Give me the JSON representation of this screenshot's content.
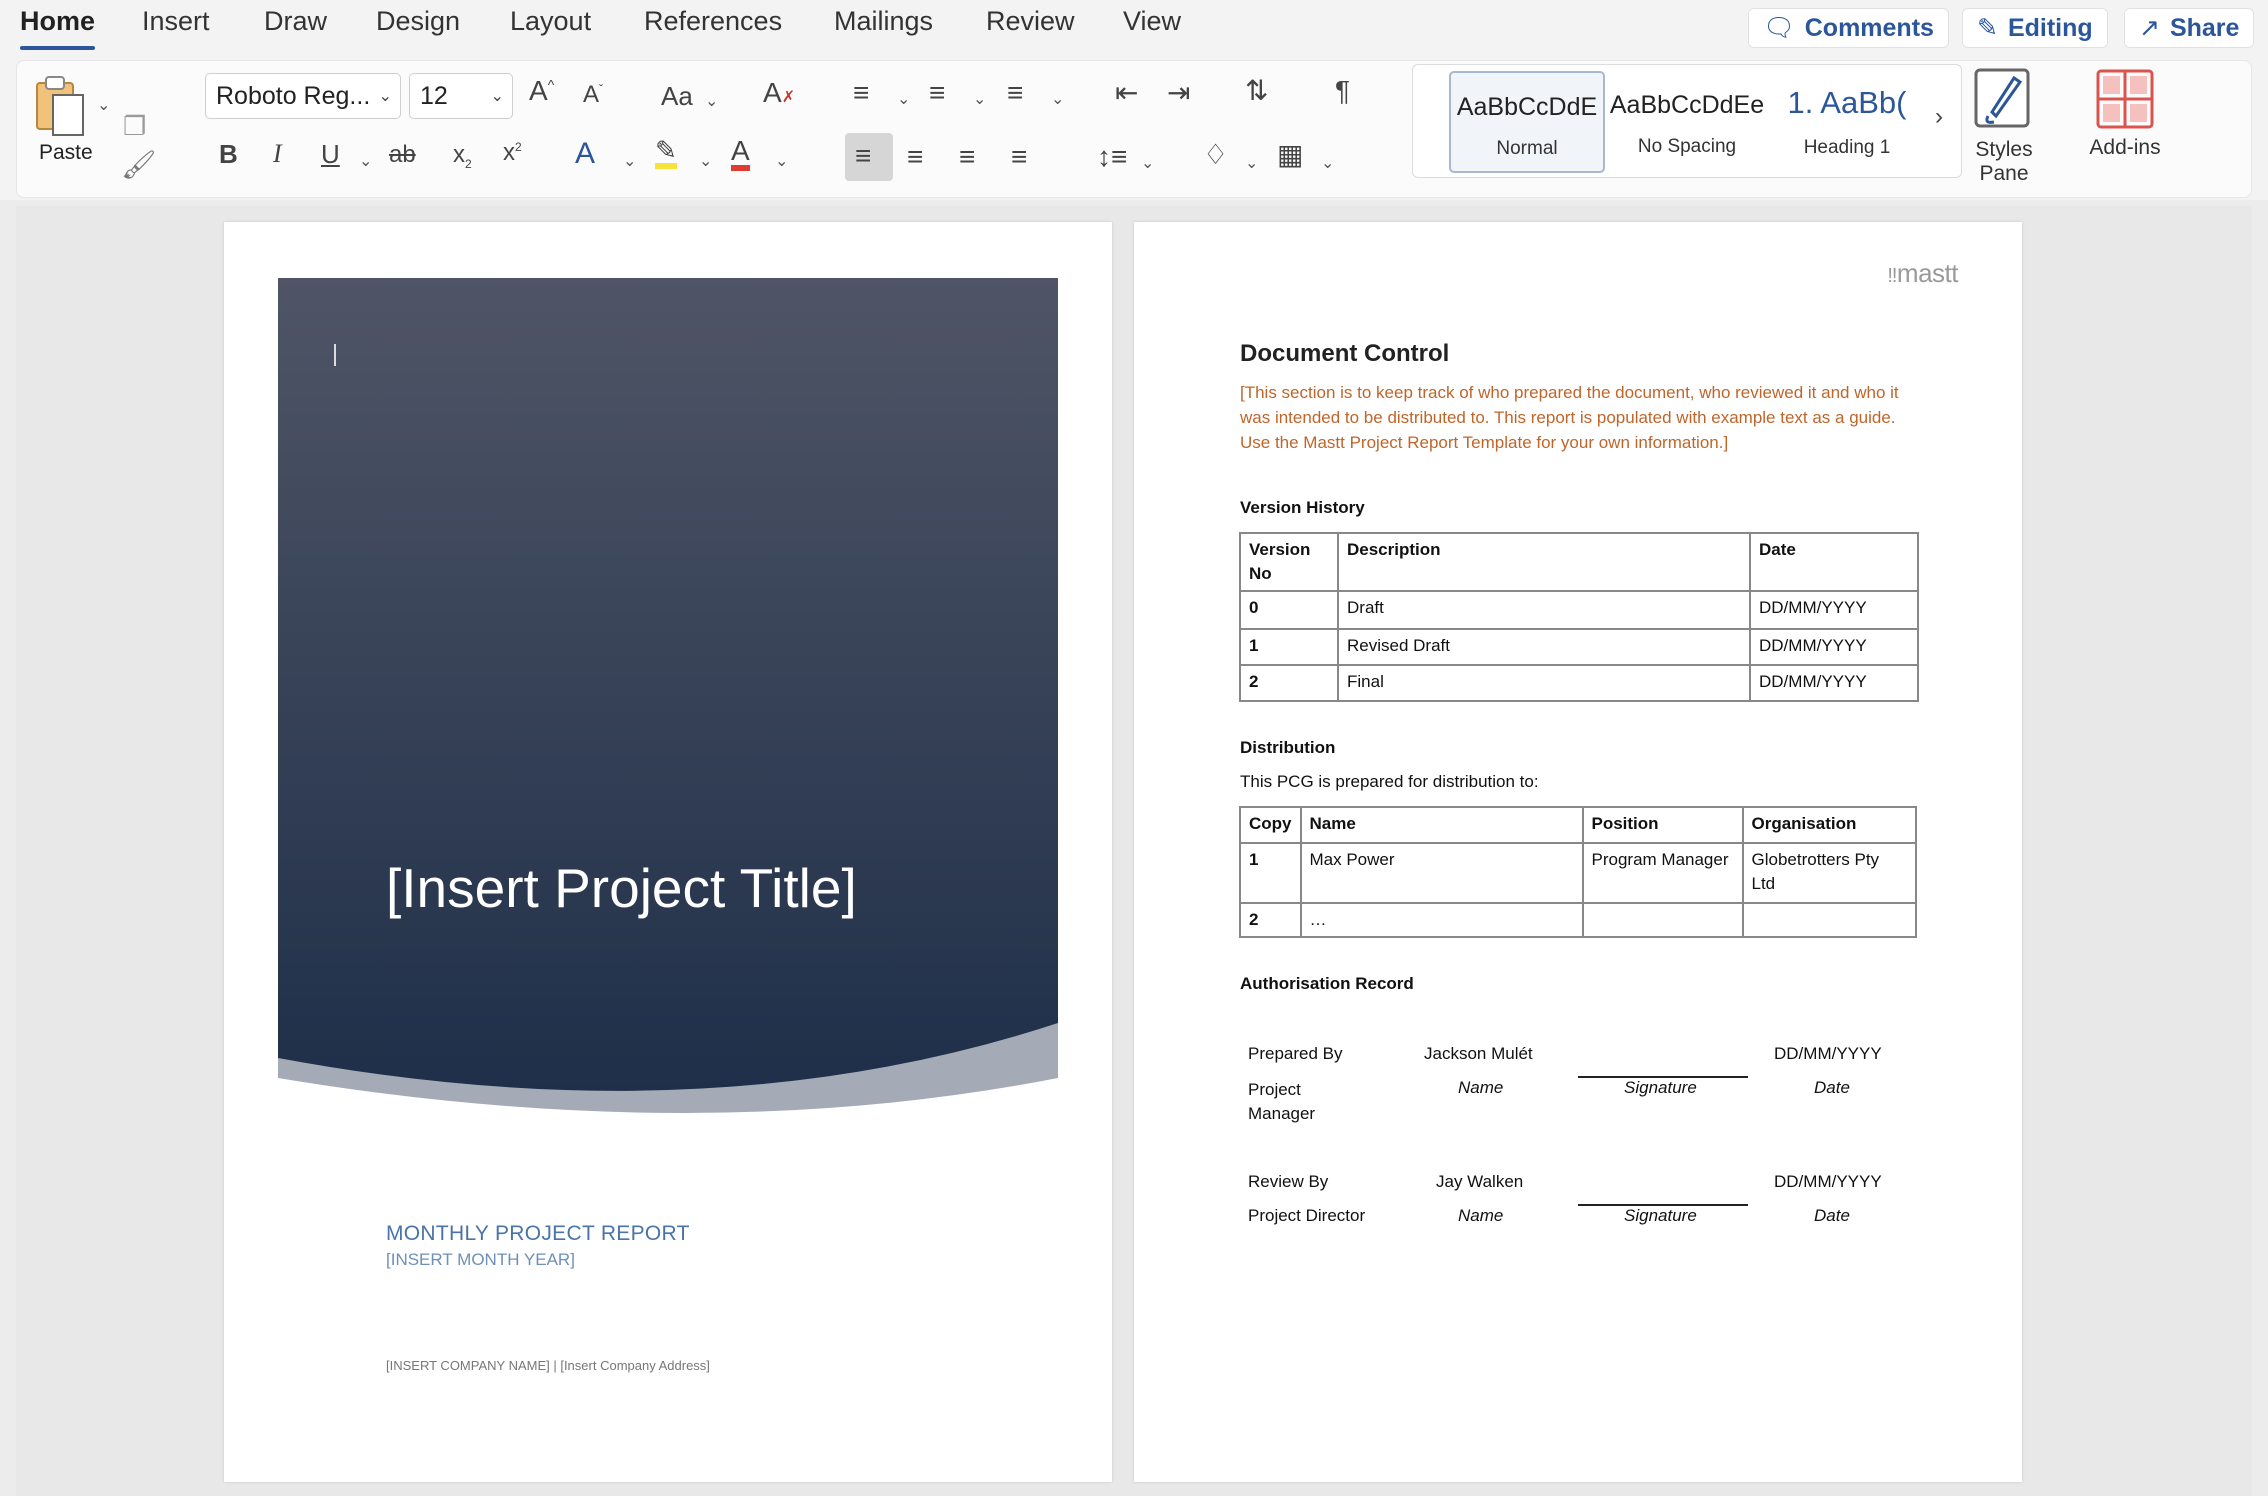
{
  "ribbon": {
    "tabs": [
      "Home",
      "Insert",
      "Draw",
      "Design",
      "Layout",
      "References",
      "Mailings",
      "Review",
      "View"
    ],
    "comments_label": "Comments",
    "editing_label": "Editing",
    "share_label": "Share",
    "paste_label": "Paste",
    "font_name": "Roboto Reg...",
    "font_size": "12",
    "styles": [
      {
        "sample": "AaBbCcDdE",
        "name": "Normal"
      },
      {
        "sample": "AaBbCcDdEe",
        "name": "No Spacing"
      },
      {
        "sample": "1. AaBb(",
        "name": "Heading 1"
      }
    ],
    "styles_pane_label": "Styles Pane",
    "addins_label": "Add-ins",
    "accent": "#2b579a"
  },
  "cover": {
    "title": "[Insert Project Title]",
    "report_label": "MONTHLY PROJECT REPORT",
    "report_date": "[INSERT MONTH YEAR]",
    "company_line": "[INSERT COMPANY NAME] | [Insert Company Address]",
    "bg_top": "#4f5566",
    "bg_bottom": "#1f2f49"
  },
  "doc": {
    "logo": "mastt",
    "heading": "Document Control",
    "intro": "[This section is to keep track of who prepared the document, who reviewed it and who it was intended to be distributed to. This report is populated with example text as a guide. Use the Mastt Project Report Template for your own information.]",
    "version_history": {
      "title": "Version History",
      "headers": [
        "Version No",
        "Description",
        "Date"
      ],
      "rows": [
        [
          "0",
          "Draft",
          "DD/MM/YYYY"
        ],
        [
          "1",
          "Revised Draft",
          "DD/MM/YYYY"
        ],
        [
          "2",
          "Final",
          "DD/MM/YYYY"
        ]
      ]
    },
    "distribution": {
      "title": "Distribution",
      "subtitle": "This PCG is prepared for distribution to:",
      "headers": [
        "Copy",
        "Name",
        "Position",
        "Organisation"
      ],
      "rows": [
        [
          "1",
          "Max Power",
          "Program Manager",
          "Globetrotters Pty Ltd"
        ],
        [
          "2",
          "…",
          "",
          ""
        ]
      ]
    },
    "authorisation": {
      "title": "Authorisation Record",
      "entries": [
        {
          "role_label": "Prepared By",
          "role": "Project Manager",
          "name": "Jackson Mulét",
          "date": "DD/MM/YYYY",
          "name_caption": "Name",
          "sig_caption": "Signature",
          "date_caption": "Date"
        },
        {
          "role_label": "Review By",
          "role": "Project Director",
          "name": "Jay Walken",
          "date": "DD/MM/YYYY",
          "name_caption": "Name",
          "sig_caption": "Signature",
          "date_caption": "Date"
        }
      ]
    }
  }
}
